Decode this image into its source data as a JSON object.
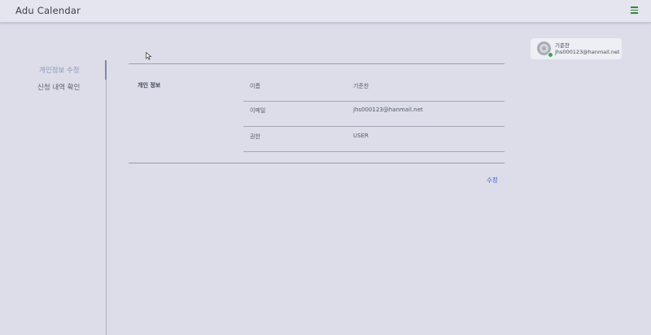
{
  "app": {
    "title": "Adu Calendar"
  },
  "profile": {
    "name": "기준찬",
    "email": "jhs000123@hanmail.net"
  },
  "sidebar": {
    "items": [
      {
        "label": "개인정보 수정",
        "active": true
      },
      {
        "label": "신청 내역 확인",
        "active": false
      }
    ]
  },
  "info": {
    "section_label": "개인 정보",
    "rows": [
      {
        "key": "이름",
        "value": "기준찬"
      },
      {
        "key": "이메일",
        "value": "jhs000123@hanmail.net"
      },
      {
        "key": "권한",
        "value": "USER"
      }
    ]
  },
  "actions": {
    "edit_label": "수정"
  },
  "colors": {
    "accent": "#7f89ab",
    "link": "#3e63c8",
    "online": "#3aa655",
    "menu_icon": "#2e8b3a"
  }
}
